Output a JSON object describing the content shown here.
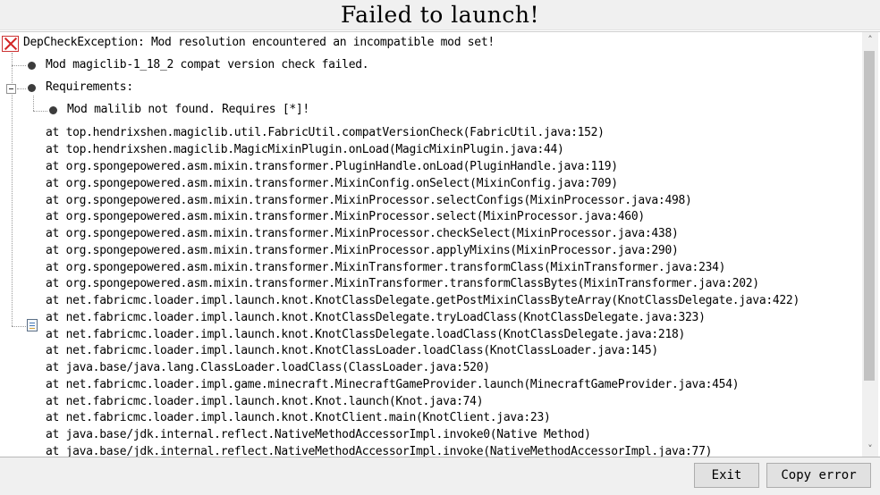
{
  "window": {
    "title": "Failed to launch!"
  },
  "icons": {
    "error": "error-x-icon",
    "bullet": "bullet-icon",
    "collapse": "collapse-minus-icon",
    "stacktrace": "document-icon"
  },
  "colors": {
    "error_red": "#d32525",
    "window_bg": "#f0f0f0",
    "panel_bg": "#ffffff",
    "button_bg": "#e1e1e1"
  },
  "tree": {
    "root": "DepCheckException: Mod resolution encountered an incompatible mod set!",
    "items": [
      "Mod magiclib-1_18_2 compat version check failed.",
      "Requirements:",
      "Mod malilib not found. Requires [*]!"
    ]
  },
  "stacktrace": [
    "at top.hendrixshen.magiclib.util.FabricUtil.compatVersionCheck(FabricUtil.java:152)",
    "at top.hendrixshen.magiclib.MagicMixinPlugin.onLoad(MagicMixinPlugin.java:44)",
    "at org.spongepowered.asm.mixin.transformer.PluginHandle.onLoad(PluginHandle.java:119)",
    "at org.spongepowered.asm.mixin.transformer.MixinConfig.onSelect(MixinConfig.java:709)",
    "at org.spongepowered.asm.mixin.transformer.MixinProcessor.selectConfigs(MixinProcessor.java:498)",
    "at org.spongepowered.asm.mixin.transformer.MixinProcessor.select(MixinProcessor.java:460)",
    "at org.spongepowered.asm.mixin.transformer.MixinProcessor.checkSelect(MixinProcessor.java:438)",
    "at org.spongepowered.asm.mixin.transformer.MixinProcessor.applyMixins(MixinProcessor.java:290)",
    "at org.spongepowered.asm.mixin.transformer.MixinTransformer.transformClass(MixinTransformer.java:234)",
    "at org.spongepowered.asm.mixin.transformer.MixinTransformer.transformClassBytes(MixinTransformer.java:202)",
    "at net.fabricmc.loader.impl.launch.knot.KnotClassDelegate.getPostMixinClassByteArray(KnotClassDelegate.java:422)",
    "at net.fabricmc.loader.impl.launch.knot.KnotClassDelegate.tryLoadClass(KnotClassDelegate.java:323)",
    "at net.fabricmc.loader.impl.launch.knot.KnotClassDelegate.loadClass(KnotClassDelegate.java:218)",
    "at net.fabricmc.loader.impl.launch.knot.KnotClassLoader.loadClass(KnotClassLoader.java:145)",
    "at java.base/java.lang.ClassLoader.loadClass(ClassLoader.java:520)",
    "at net.fabricmc.loader.impl.game.minecraft.MinecraftGameProvider.launch(MinecraftGameProvider.java:454)",
    "at net.fabricmc.loader.impl.launch.knot.Knot.launch(Knot.java:74)",
    "at net.fabricmc.loader.impl.launch.knot.KnotClient.main(KnotClient.java:23)",
    "at java.base/jdk.internal.reflect.NativeMethodAccessorImpl.invoke0(Native Method)",
    "at java.base/jdk.internal.reflect.NativeMethodAccessorImpl.invoke(NativeMethodAccessorImpl.java:77)"
  ],
  "buttons": {
    "exit": "Exit",
    "copy_error": "Copy error"
  }
}
